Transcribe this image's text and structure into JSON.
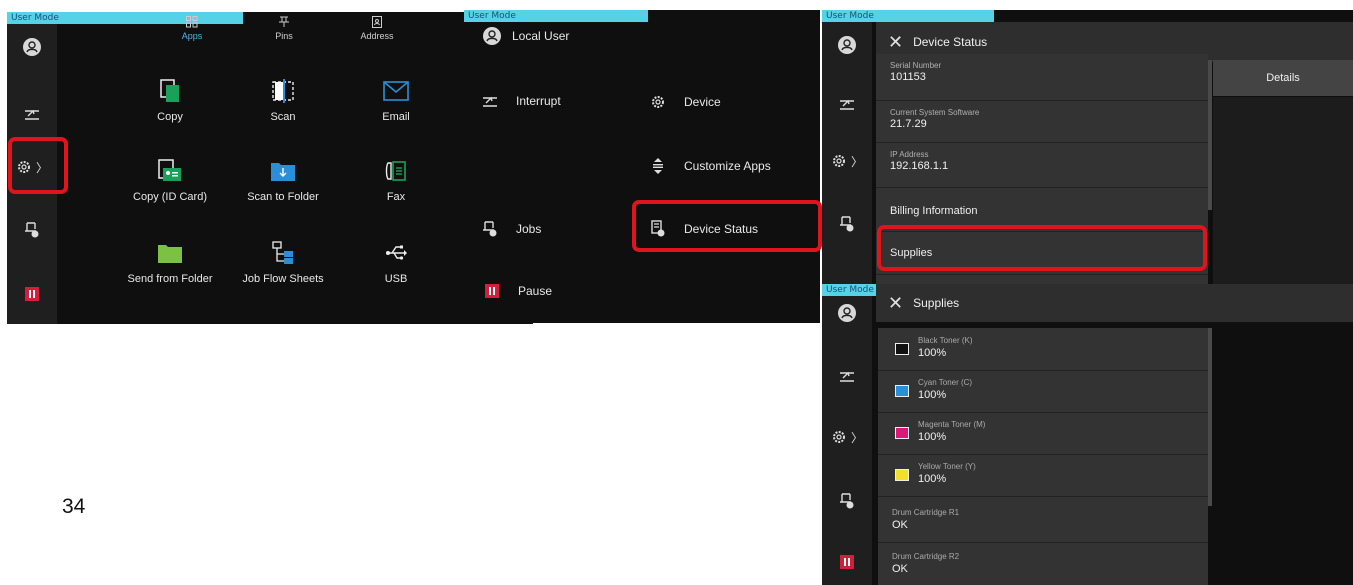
{
  "mode_label": "User Mode",
  "accent_color": "#55d2e6",
  "highlight_color": "#e0141c",
  "page_number": "34",
  "screen1": {
    "tabs": [
      {
        "label": "Apps",
        "icon": "apps-grid-icon",
        "active": true
      },
      {
        "label": "Pins",
        "icon": "pin-icon",
        "active": false
      },
      {
        "label": "Address",
        "icon": "address-book-icon",
        "active": false
      }
    ],
    "sidebar_icons": [
      "user-icon",
      "interrupt-icon",
      "settings-gear-icon",
      "jobs-icon",
      "pause-icon"
    ],
    "settings_chevron": "〉",
    "apps": [
      {
        "label": "Copy",
        "icon": "copy-icon"
      },
      {
        "label": "Scan",
        "icon": "scan-icon"
      },
      {
        "label": "Email",
        "icon": "email-icon"
      },
      {
        "label": "Copy (ID Card)",
        "icon": "id-card-copy-icon"
      },
      {
        "label": "Scan to Folder",
        "icon": "scan-to-folder-icon"
      },
      {
        "label": "Fax",
        "icon": "fax-icon"
      },
      {
        "label": "Send from Folder",
        "icon": "folder-icon"
      },
      {
        "label": "Job Flow Sheets",
        "icon": "job-flow-icon"
      },
      {
        "label": "USB",
        "icon": "usb-icon"
      }
    ]
  },
  "screen2": {
    "items": {
      "local_user": "Local User",
      "interrupt": "Interrupt",
      "device": "Device",
      "customize_apps": "Customize Apps",
      "jobs": "Jobs",
      "device_status": "Device Status",
      "pause": "Pause"
    }
  },
  "screen3": {
    "title": "Device Status",
    "settings_chevron": "〉",
    "info": [
      {
        "label": "Serial Number",
        "value": "101153"
      },
      {
        "label": "Current System Software",
        "value": "21.7.29"
      },
      {
        "label": "IP Address",
        "value": "192.168.1.1"
      }
    ],
    "links": {
      "billing": "Billing Information",
      "supplies": "Supplies"
    },
    "details_button": "Details"
  },
  "screen4": {
    "title": "Supplies",
    "settings_chevron": "〉",
    "toners": [
      {
        "label": "Black Toner (K)",
        "value": "100%",
        "color": "#111111"
      },
      {
        "label": "Cyan Toner (C)",
        "value": "100%",
        "color": "#2a8fd6"
      },
      {
        "label": "Magenta Toner (M)",
        "value": "100%",
        "color": "#d8197a"
      },
      {
        "label": "Yellow Toner (Y)",
        "value": "100%",
        "color": "#f2df2a"
      }
    ],
    "drums": [
      {
        "label": "Drum Cartridge R1",
        "value": "OK"
      },
      {
        "label": "Drum Cartridge R2",
        "value": "OK"
      }
    ]
  }
}
